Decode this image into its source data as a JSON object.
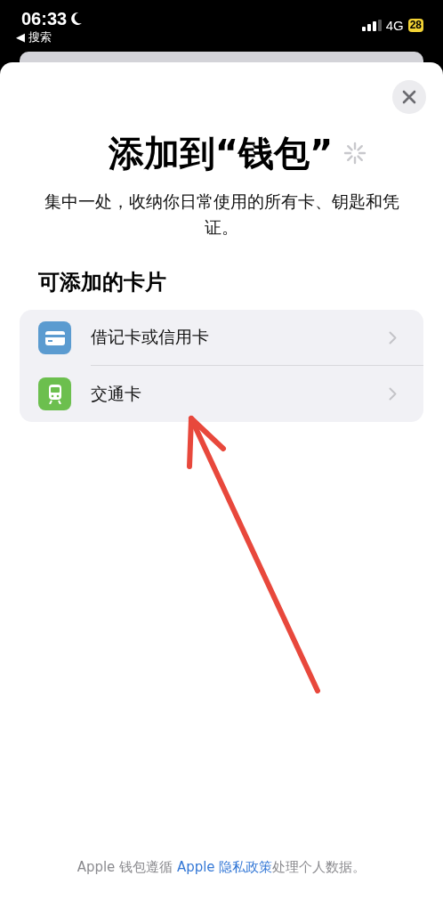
{
  "status_bar": {
    "time": "06:33",
    "back_label": "◀ 搜索",
    "network": "4G",
    "battery": "28"
  },
  "sheet": {
    "title": "添加到“钱包”",
    "subtitle": "集中一处，收纳你日常使用的所有卡、钥匙和凭证。",
    "section_title": "可添加的卡片",
    "items": [
      {
        "kind": "card",
        "label": "借记卡或信用卡",
        "color": "#5b9bd0"
      },
      {
        "kind": "transit",
        "label": "交通卡",
        "color": "#6cbf4e"
      }
    ],
    "footer": {
      "text_before": "Apple 钱包遵循 ",
      "link": "Apple 隐私政策",
      "text_after": "处理个人数据。"
    }
  }
}
